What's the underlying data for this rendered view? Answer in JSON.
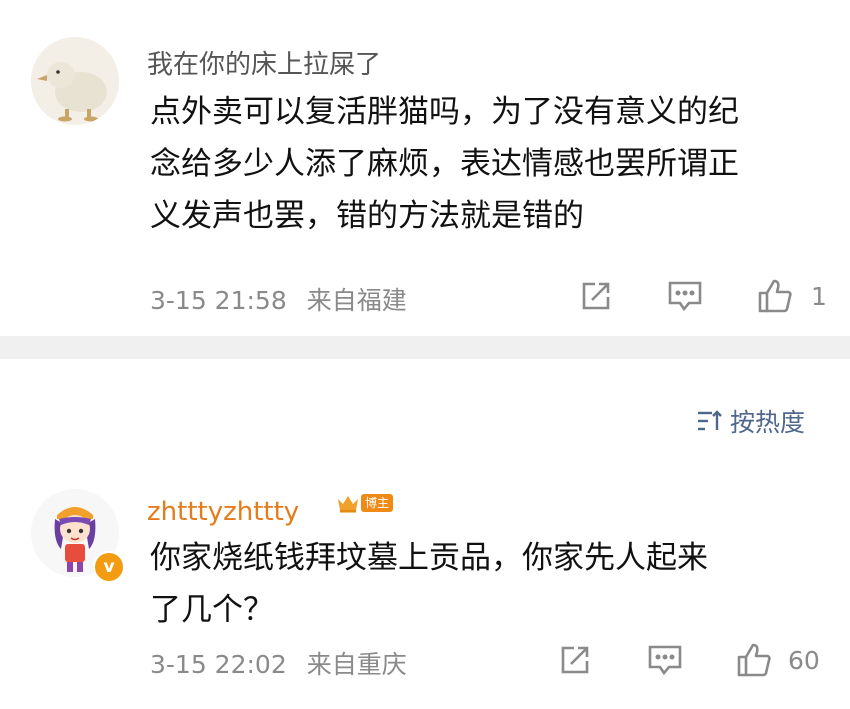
{
  "comments": [
    {
      "username": "我在你的床上拉屎了",
      "text_lines": [
        "点外卖可以复活胖猫吗，为了没有意义的纪",
        "念给多少人添了麻烦，表达情感也罢所谓正",
        "义发声也罢，错的方法就是错的"
      ],
      "time": "3-15 21:58",
      "location": "来自福建",
      "like_count": "1",
      "avatar_icon": "duck-avatar-icon"
    },
    {
      "username": "zhtttyzhttty",
      "badge": "博主",
      "text_lines": [
        "你家烧纸钱拜坟墓上贡品，你家先人起来",
        "了几个？"
      ],
      "time": "3-15 22:02",
      "location": "来自重庆",
      "like_count": "60",
      "avatar_icon": "anime-character-avatar-icon",
      "verified_mark": "v"
    }
  ],
  "sort": {
    "label": "按热度",
    "icon": "sort-lines-icon"
  },
  "colors": {
    "username_gray": "#555555",
    "username_orange": "#e57c1c",
    "meta_gray": "#8a8a8a",
    "sort_blue": "#50678c",
    "divider": "#f0f0f0",
    "badge_orange": "#f08a16"
  }
}
